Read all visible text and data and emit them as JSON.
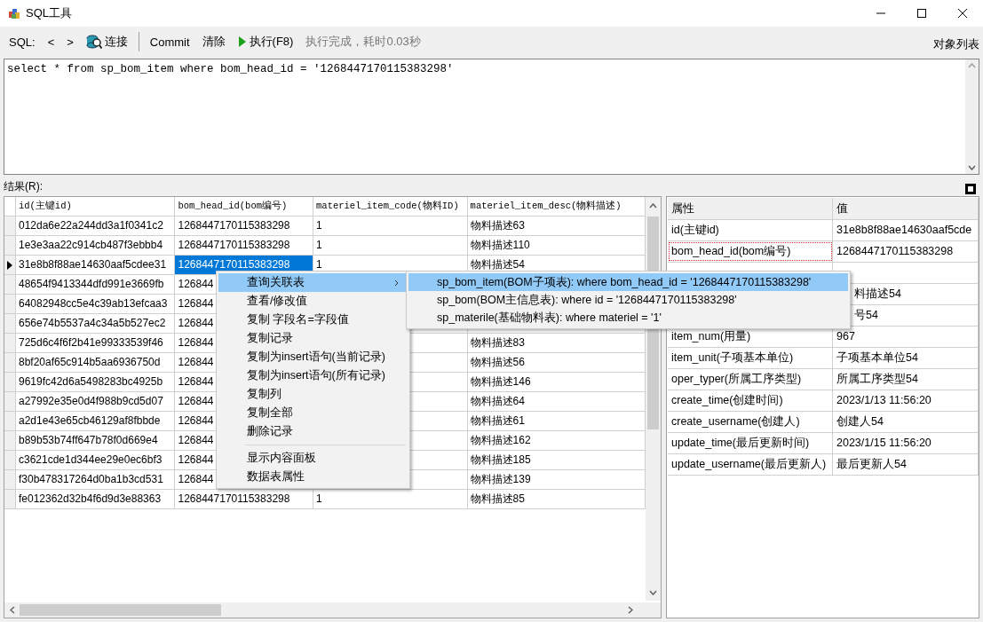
{
  "window": {
    "title": "SQL工具"
  },
  "toolbar": {
    "items": [
      {
        "kind": "text",
        "label": "SQL:"
      },
      {
        "kind": "button",
        "label": "<"
      },
      {
        "kind": "button",
        "label": ">"
      },
      {
        "kind": "connect",
        "label": "连接"
      },
      {
        "kind": "separator"
      },
      {
        "kind": "button",
        "label": "Commit"
      },
      {
        "kind": "button",
        "label": "清除"
      },
      {
        "kind": "run",
        "label": "执行(F8)"
      },
      {
        "kind": "status",
        "label": "执行完成，耗时0.03秒"
      }
    ],
    "object_list": "对象列表"
  },
  "editor": {
    "value": "select * from sp_bom_item where bom_head_id = '1268447170115383298'"
  },
  "results": {
    "label": "结果(R):"
  },
  "grid": {
    "columns": [
      {
        "label": "id(主键id)",
        "selected": false
      },
      {
        "label": "bom_head_id(bom编号)",
        "selected": true
      },
      {
        "label": "materiel_item_code(物料ID)",
        "selected": false
      },
      {
        "label": "materiel_item_desc(物料描述)",
        "selected": false
      }
    ],
    "rows": [
      {
        "selected": false,
        "cells": [
          "012da6e22a244dd3a1f0341c2",
          "1268447170115383298",
          "1",
          "物料描述63"
        ]
      },
      {
        "selected": false,
        "cells": [
          "1e3e3aa22c914cb487f3ebbb4",
          "1268447170115383298",
          "1",
          "物料描述110"
        ]
      },
      {
        "selected": true,
        "cells": [
          "31e8b8f88ae14630aaf5cdee31",
          "1268447170115383298",
          "1",
          "物料描述54"
        ]
      },
      {
        "selected": false,
        "cells": [
          "48654f9413344dfd991e3669fb",
          "126844",
          null,
          null
        ]
      },
      {
        "selected": false,
        "cells": [
          "64082948cc5e4c39ab13efcaa3",
          "126844",
          null,
          null
        ]
      },
      {
        "selected": false,
        "cells": [
          "656e74b5537a4c34a5b527ec2",
          "126844",
          null,
          null
        ]
      },
      {
        "selected": false,
        "cells": [
          "725d6c4f6f2b41e99333539f46",
          "126844",
          null,
          "物料描述83"
        ]
      },
      {
        "selected": false,
        "cells": [
          "8bf20af65c914b5aa6936750d",
          "126844",
          null,
          "物料描述56"
        ]
      },
      {
        "selected": false,
        "cells": [
          "9619fc42d6a5498283bc4925b",
          "126844",
          null,
          "物料描述146"
        ]
      },
      {
        "selected": false,
        "cells": [
          "a27992e35e0d4f988b9cd5d07",
          "126844",
          null,
          "物料描述64"
        ]
      },
      {
        "selected": false,
        "cells": [
          "a2d1e43e65cb46129af8fbbde",
          "126844",
          null,
          "物料描述61"
        ]
      },
      {
        "selected": false,
        "cells": [
          "b89b53b74ff647b78f0d669e4",
          "126844",
          null,
          "物料描述162"
        ]
      },
      {
        "selected": false,
        "cells": [
          "c3621cde1d344ee29e0ec6bf3",
          "126844",
          null,
          "物料描述185"
        ]
      },
      {
        "selected": false,
        "cells": [
          "f30b478317264d0ba1b3cd531",
          "126844",
          null,
          "物料描述139"
        ]
      },
      {
        "selected": false,
        "cells": [
          "fe012362d32b4f6d9d3e88363",
          "1268447170115383298",
          "1",
          "物料描述85"
        ]
      }
    ]
  },
  "properties": {
    "columns": [
      "属性",
      "值"
    ],
    "rows": [
      {
        "property": "id(主键id)",
        "value": "31e8b8f88ae14630aaf5cde",
        "focused": false
      },
      {
        "property": "bom_head_id(bom编号)",
        "value": "1268447170115383298",
        "focused": true
      },
      {},
      {
        "value": "料描述54"
      },
      {
        "value": "号54"
      },
      {
        "property": "item_num(用量)",
        "value": "967",
        "focused": false
      },
      {
        "property": "item_unit(子项基本单位)",
        "value": "子项基本单位54",
        "focused": false
      },
      {
        "property": "oper_typer(所属工序类型)",
        "value": "所属工序类型54",
        "focused": false
      },
      {
        "property": "create_time(创建时间)",
        "value": "2023/1/13 11:56:20",
        "focused": false
      },
      {
        "property": "create_username(创建人)",
        "value": "创建人54",
        "focused": false
      },
      {
        "property": "update_time(最后更新时间)",
        "value": "2023/1/15 11:56:20",
        "focused": false
      },
      {
        "property": "update_username(最后更新人)",
        "value": "最后更新人54",
        "focused": false
      }
    ]
  },
  "context_menu": {
    "items": [
      {
        "kind": "item",
        "label": "查询关联表",
        "selected": true,
        "submenu": true
      },
      {
        "kind": "item",
        "label": "查看/修改值",
        "selected": false,
        "submenu": false
      },
      {
        "kind": "item",
        "label": "复制 字段名=字段值",
        "selected": false,
        "submenu": false
      },
      {
        "kind": "item",
        "label": "复制记录",
        "selected": false,
        "submenu": false
      },
      {
        "kind": "item",
        "label": "复制为insert语句(当前记录)",
        "selected": false,
        "submenu": false
      },
      {
        "kind": "item",
        "label": "复制为insert语句(所有记录)",
        "selected": false,
        "submenu": false
      },
      {
        "kind": "item",
        "label": "复制列",
        "selected": false,
        "submenu": false
      },
      {
        "kind": "item",
        "label": "复制全部",
        "selected": false,
        "submenu": false
      },
      {
        "kind": "item",
        "label": "删除记录",
        "selected": false,
        "submenu": false
      },
      {
        "kind": "separator"
      },
      {
        "kind": "item",
        "label": "显示内容面板",
        "selected": false,
        "submenu": false
      },
      {
        "kind": "item",
        "label": "数据表属性",
        "selected": false,
        "submenu": false
      }
    ],
    "submenu": [
      {
        "label": "sp_bom_item(BOM子项表): where bom_head_id = '1268447170115383298'",
        "selected": true
      },
      {
        "label": "sp_bom(BOM主信息表): where id = '1268447170115383298'",
        "selected": false
      },
      {
        "label": "sp_materile(基础物料表): where materiel = '1'",
        "selected": false
      }
    ]
  }
}
